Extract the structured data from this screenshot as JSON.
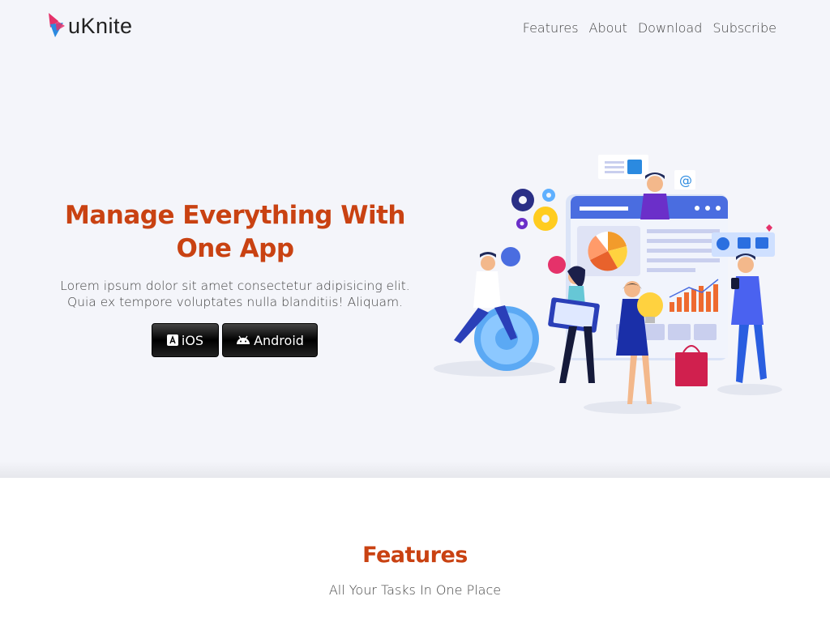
{
  "brand": {
    "name": "uKnite",
    "primary": "#c94212",
    "logo_pink": "#e5326a",
    "logo_blue": "#2b8ae0"
  },
  "nav": {
    "items": [
      {
        "label": "Features"
      },
      {
        "label": "About"
      },
      {
        "label": "Download"
      },
      {
        "label": "Subscribe"
      }
    ]
  },
  "hero": {
    "title": "Manage Everything With One App",
    "text": "Lorem ipsum dolor sit amet consectetur adipisicing elit. Quia ex tempore voluptates nulla blanditiis! Aliquam.",
    "ios_label": "iOS",
    "android_label": "Android",
    "ios_icon": "app-store-icon",
    "android_icon": "android-icon"
  },
  "features": {
    "title": "Features",
    "subtitle": "All Your Tasks In One Place"
  }
}
